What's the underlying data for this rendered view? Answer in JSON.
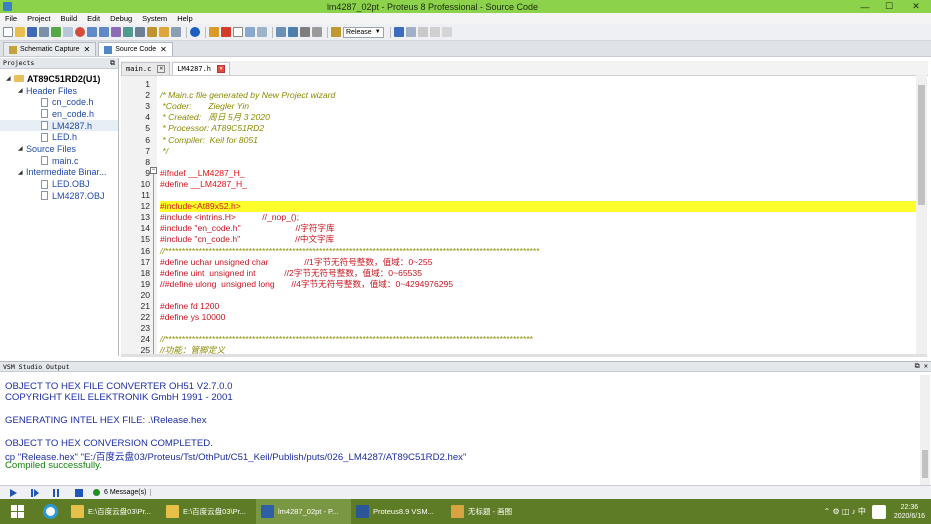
{
  "window": {
    "title": "lm4287_02pt - Proteus 8 Professional - Source Code",
    "minimize": "—",
    "maximize": "☐",
    "close": "✕"
  },
  "menu": [
    "File",
    "Project",
    "Build",
    "Edit",
    "Debug",
    "System",
    "Help"
  ],
  "toolbar": {
    "build_config": "Release"
  },
  "doc_tabs": [
    {
      "label": "Schematic Capture",
      "close": "✕",
      "active": false
    },
    {
      "label": "Source Code",
      "close": "✕",
      "active": true
    }
  ],
  "projects": {
    "header": "Projects",
    "pin": "⧉",
    "tree": [
      {
        "label": "AT89C51RD2(U1)",
        "kind": "root",
        "arrow": "◢"
      },
      {
        "label": "Header Files",
        "kind": "group",
        "arrow": "◢"
      },
      {
        "label": "cn_code.h",
        "kind": "file"
      },
      {
        "label": "en_code.h",
        "kind": "file"
      },
      {
        "label": "LM4287.h",
        "kind": "file",
        "selected": true
      },
      {
        "label": "LED.h",
        "kind": "file"
      },
      {
        "label": "Source Files",
        "kind": "group",
        "arrow": "◢"
      },
      {
        "label": "main.c",
        "kind": "file"
      },
      {
        "label": "Intermediate Binar...",
        "kind": "group",
        "arrow": "◢"
      },
      {
        "label": "LED.OBJ",
        "kind": "file"
      },
      {
        "label": "LM4287.OBJ",
        "kind": "file"
      }
    ]
  },
  "editor": {
    "tabs": [
      {
        "label": "main.c",
        "active": false,
        "close": "×"
      },
      {
        "label": "LM4287.h",
        "active": true,
        "close": "×"
      }
    ],
    "fold_marker": "−",
    "lines": [
      {
        "n": "1",
        "text": "",
        "cls": ""
      },
      {
        "n": "2",
        "text": "/* Main.c file generated by New Project wizard",
        "cls": "c-cm"
      },
      {
        "n": "3",
        "text": " *Coder:       Ziegler Yin",
        "cls": "c-cm"
      },
      {
        "n": "4",
        "text": " * Created:   周日 5月 3 2020",
        "cls": "c-cm"
      },
      {
        "n": "5",
        "text": " * Processor: AT89C51RD2",
        "cls": "c-cm"
      },
      {
        "n": "6",
        "text": " * Compiler:  Keil for 8051",
        "cls": "c-cm"
      },
      {
        "n": "7",
        "text": " */",
        "cls": "c-cm"
      },
      {
        "n": "8",
        "text": "",
        "cls": ""
      },
      {
        "n": "9",
        "text": "#ifndef __LM4287_H_",
        "cls": "c-pp"
      },
      {
        "n": "10",
        "text": "#define __LM4287_H_",
        "cls": "c-pp"
      },
      {
        "n": "11",
        "text": "",
        "cls": ""
      },
      {
        "n": "12",
        "text": "#include<At89x52.h>",
        "cls": "c-incr",
        "hl": true
      },
      {
        "n": "13",
        "text": "#include <intrins.H>           //_nop_();",
        "cls": "c-inc"
      },
      {
        "n": "14",
        "text": "#include \"en_code.h\"                       //字符字库",
        "cls": "c-inc"
      },
      {
        "n": "15",
        "text": "#include \"cn_code.h\"                       //中文字库",
        "cls": "c-inc"
      },
      {
        "n": "16",
        "text": "//****************************************************************************************************************",
        "cls": "c-cm"
      },
      {
        "n": "17",
        "text": "#define uchar unsigned char               //1字节无符号整数，值域：0~255",
        "cls": "c-inc"
      },
      {
        "n": "18",
        "text": "#define uint  unsigned int            //2字节无符号整数，值域：0~65535",
        "cls": "c-inc"
      },
      {
        "n": "19",
        "text": "//#define ulong  unsigned long       //4字节无符号整数，值域：0~4294976295",
        "cls": "c-inc"
      },
      {
        "n": "20",
        "text": "",
        "cls": ""
      },
      {
        "n": "21",
        "text": "#define fd 1200",
        "cls": "c-inc"
      },
      {
        "n": "22",
        "text": "#define ys 10000",
        "cls": "c-inc"
      },
      {
        "n": "23",
        "text": "",
        "cls": ""
      },
      {
        "n": "24",
        "text": "//**************************************************************************************************************",
        "cls": "c-cm"
      },
      {
        "n": "25",
        "text": "//功能：管脚定义",
        "cls": "c-cm"
      }
    ]
  },
  "output": {
    "header": "VSM Studio Output",
    "pin": "⧉ ✕",
    "lines": [
      {
        "text": "OBJECT TO HEX FILE CONVERTER OH51 V2.7.0.0",
        "ok": false
      },
      {
        "text": "COPYRIGHT KEIL ELEKTRONIK GmbH 1991 - 2001",
        "ok": false
      },
      {
        "text": "",
        "ok": false
      },
      {
        "text": "GENERATING INTEL HEX FILE: .\\Release.hex",
        "ok": false
      },
      {
        "text": "",
        "ok": false
      },
      {
        "text": "OBJECT TO HEX CONVERSION COMPLETED.",
        "ok": false
      },
      {
        "text": "cp \"Release.hex\" \"E:/百度云盘03/Proteus/Tst/OthPut/C51_Keil/Publish/puts/026_LM4287/AT89C51RD2.hex\"",
        "ok": false
      },
      {
        "text": "Compiled successfully.",
        "ok": true
      }
    ]
  },
  "status": {
    "messages": "6 Message(s)"
  },
  "taskbar": {
    "tasks": [
      {
        "label": "E:\\百度云盘03\\Pr...",
        "color": "#e6c048",
        "active": false
      },
      {
        "label": "E:\\百度云盘03\\Pr...",
        "color": "#e6c048",
        "active": false
      },
      {
        "label": "lm4287_02pt - P...",
        "color": "#2d5fa6",
        "active": true
      },
      {
        "label": "Proteus8.9 VSM...",
        "color": "#2b5797",
        "active": false
      },
      {
        "label": "无标题 - 画图",
        "color": "#d7a43f",
        "active": false
      }
    ],
    "time": "22:36",
    "date": "2020/6/16",
    "tray_icons": "⌃ ⚙ ◫ ♪ 中"
  }
}
